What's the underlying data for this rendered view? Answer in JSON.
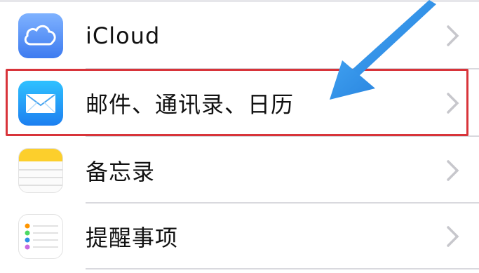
{
  "settings_list": {
    "items": [
      {
        "label": "iCloud",
        "icon": "icloud-icon"
      },
      {
        "label": "邮件、通讯录、日历",
        "icon": "mail-icon"
      },
      {
        "label": "备忘录",
        "icon": "notes-icon"
      },
      {
        "label": "提醒事项",
        "icon": "reminders-icon"
      }
    ]
  },
  "colors": {
    "highlight_border": "#d8343a",
    "arrow": "#2f8ee8",
    "chevron": "#c7c7cc"
  }
}
